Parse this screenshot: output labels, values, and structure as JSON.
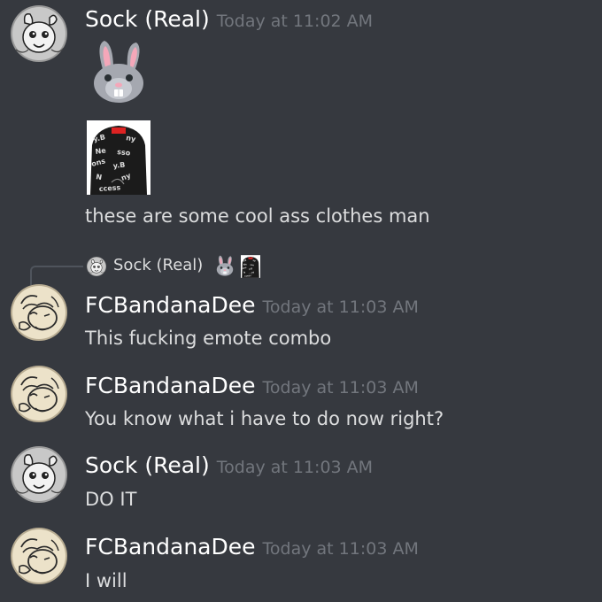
{
  "messages": [
    {
      "author": "Sock (Real)",
      "timestamp": "Today at 11:02 AM",
      "emojis": [
        "rabbit-face",
        "hoodie-emote"
      ],
      "text": "these are some cool ass clothes man"
    },
    {
      "author": "FCBandanaDee",
      "timestamp": "Today at 11:03 AM",
      "reply": {
        "author": "Sock (Real)",
        "emojis": [
          "rabbit-face",
          "hoodie-emote"
        ]
      },
      "text": "This fucking emote combo"
    },
    {
      "author": "FCBandanaDee",
      "timestamp": "Today at 11:03 AM",
      "text": "You know what i have to do now right?"
    },
    {
      "author": "Sock (Real)",
      "timestamp": "Today at 11:03 AM",
      "text": "DO IT"
    },
    {
      "author": "FCBandanaDee",
      "timestamp": "Today at 11:03 AM",
      "text": "I will"
    }
  ],
  "colors": {
    "background": "#36393f",
    "username": "#ffffff",
    "timestamp": "#72767d",
    "text": "#dcddde",
    "reply_line": "#4f545c"
  }
}
